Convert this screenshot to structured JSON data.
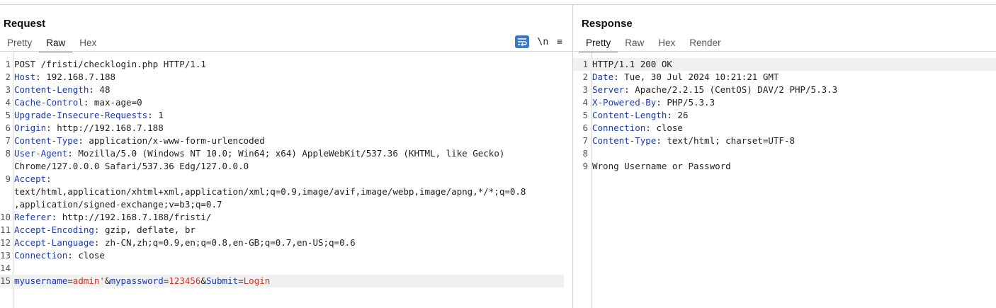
{
  "request": {
    "title": "Request",
    "tabs": [
      "Pretty",
      "Raw",
      "Hex"
    ],
    "active_tab": "Raw",
    "tools": {
      "newline_label": "\\n",
      "menu_glyph": "≡"
    },
    "lines": [
      {
        "n": "1",
        "text": "POST /fristi/checklogin.php HTTP/1.1"
      },
      {
        "n": "2",
        "key": "Host",
        "val": " 192.168.7.188"
      },
      {
        "n": "3",
        "key": "Content-Length",
        "val": " 48"
      },
      {
        "n": "4",
        "key": "Cache-Control",
        "val": " max-age=0"
      },
      {
        "n": "5",
        "key": "Upgrade-Insecure-Requests",
        "val": " 1"
      },
      {
        "n": "6",
        "key": "Origin",
        "val": " http://192.168.7.188"
      },
      {
        "n": "7",
        "key": "Content-Type",
        "val": " application/x-www-form-urlencoded"
      },
      {
        "n": "8",
        "key": "User-Agent",
        "val": " Mozilla/5.0 (Windows NT 10.0; Win64; x64) AppleWebKit/537.36 (KHTML, like Gecko)"
      },
      {
        "n": "",
        "text": "Chrome/127.0.0.0 Safari/537.36 Edg/127.0.0.0"
      },
      {
        "n": "9",
        "key": "Accept",
        "val": ""
      },
      {
        "n": "",
        "text": "text/html,application/xhtml+xml,application/xml;q=0.9,image/avif,image/webp,image/apng,*/*;q=0.8"
      },
      {
        "n": "",
        "text": ",application/signed-exchange;v=b3;q=0.7"
      },
      {
        "n": "10",
        "key": "Referer",
        "val": " http://192.168.7.188/fristi/"
      },
      {
        "n": "11",
        "key": "Accept-Encoding",
        "val": " gzip, deflate, br"
      },
      {
        "n": "12",
        "key": "Accept-Language",
        "val": " zh-CN,zh;q=0.9,en;q=0.8,en-GB;q=0.7,en-US;q=0.6"
      },
      {
        "n": "13",
        "key": "Connection",
        "val": " close"
      },
      {
        "n": "14",
        "text": ""
      },
      {
        "n": "15",
        "params": [
          {
            "k": "myusername",
            "v": "admin'"
          },
          {
            "k": "mypassword",
            "v": "123456"
          },
          {
            "k": "Submit",
            "v": "Login"
          }
        ]
      }
    ]
  },
  "response": {
    "title": "Response",
    "tabs": [
      "Pretty",
      "Raw",
      "Hex",
      "Render"
    ],
    "active_tab": "Pretty",
    "lines": [
      {
        "n": "1",
        "text": "HTTP/1.1 200 OK"
      },
      {
        "n": "2",
        "key": "Date",
        "val": " Tue, 30 Jul 2024 10:21:21 GMT"
      },
      {
        "n": "3",
        "key": "Server",
        "val": " Apache/2.2.15 (CentOS) DAV/2 PHP/5.3.3"
      },
      {
        "n": "4",
        "key": "X-Powered-By",
        "val": " PHP/5.3.3"
      },
      {
        "n": "5",
        "key": "Content-Length",
        "val": " 26"
      },
      {
        "n": "6",
        "key": "Connection",
        "val": " close"
      },
      {
        "n": "7",
        "key": "Content-Type",
        "val": " text/html; charset=UTF-8"
      },
      {
        "n": "8",
        "text": ""
      },
      {
        "n": "9",
        "text": "Wrong Username or Password"
      }
    ]
  },
  "colors": {
    "accent": "#e8541e",
    "header_key": "#1e3aa8",
    "param_value": "#c0392b",
    "tool_button": "#3b78c4"
  }
}
